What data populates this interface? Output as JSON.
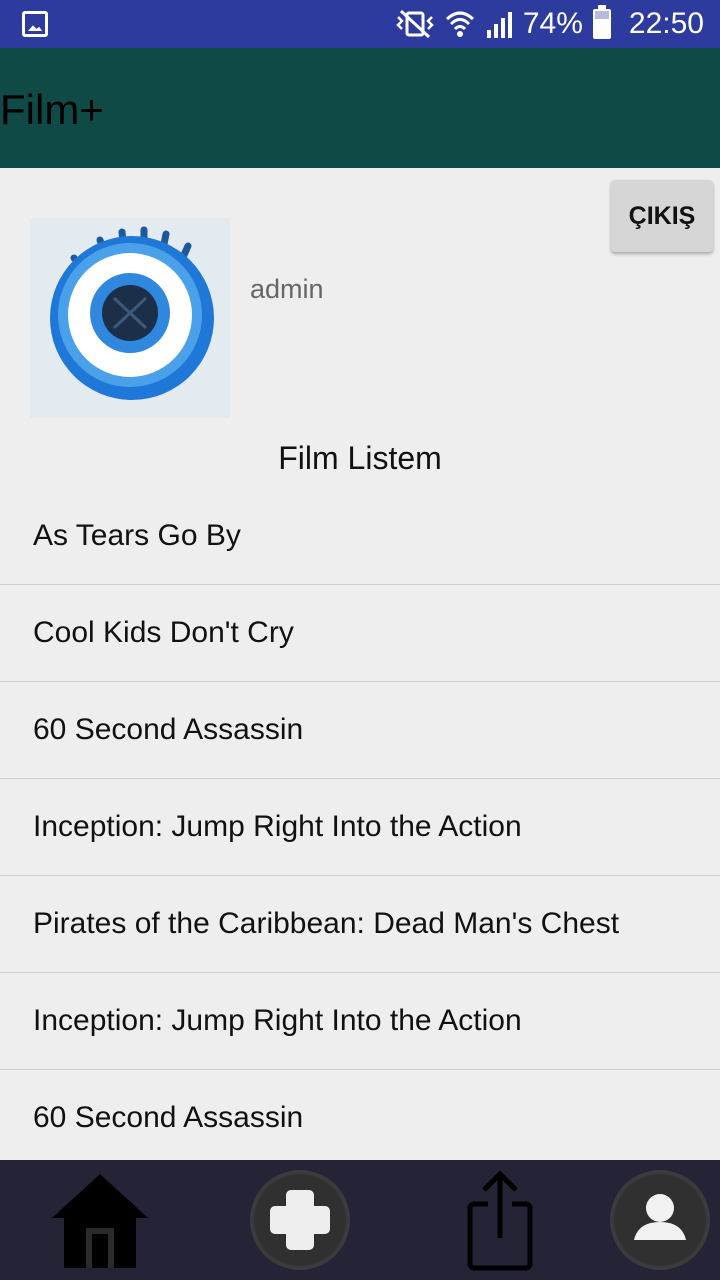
{
  "status_bar": {
    "battery": "74%",
    "time": "22:50",
    "icons": [
      "gallery-icon",
      "vibrate-icon",
      "wifi-icon",
      "signal-icon",
      "battery-icon"
    ]
  },
  "app": {
    "title": "Film+"
  },
  "profile": {
    "username": "admin",
    "logout_label": "ÇIKIŞ",
    "avatar_icon": "eye-icon"
  },
  "list": {
    "title": "Film Listem",
    "items": [
      "As Tears Go By",
      "Cool Kids Don't Cry",
      "60 Second Assassin",
      "Inception: Jump Right Into the Action",
      "Pirates of the Caribbean: Dead Man's Chest",
      "Inception: Jump Right Into the Action",
      "60 Second Assassin"
    ]
  },
  "bottom_nav": {
    "items": [
      "home-icon",
      "add-icon",
      "share-icon",
      "profile-icon"
    ]
  },
  "colors": {
    "status_bar": "#2e3b9e",
    "app_bar": "#0f4a46",
    "background": "#eeeeee",
    "bottom_nav": "#252437"
  }
}
